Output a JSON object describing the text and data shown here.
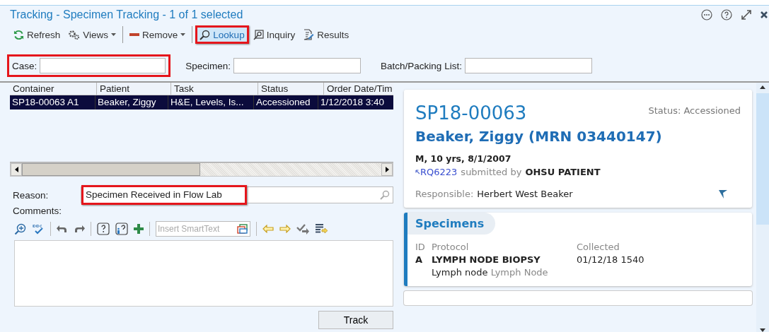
{
  "window": {
    "title": "Tracking - Specimen Tracking - 1 of 1 selected"
  },
  "toolbar": [
    {
      "kind": "refresh",
      "label": "Refresh",
      "dropdown": false,
      "highlighted": false
    },
    {
      "kind": "views",
      "label": "Views",
      "dropdown": true,
      "highlighted": false
    },
    {
      "kind": "remove",
      "label": "Remove",
      "dropdown": true,
      "highlighted": false
    },
    {
      "kind": "lookup",
      "label": "Lookup",
      "dropdown": false,
      "highlighted": true
    },
    {
      "kind": "inquiry",
      "label": "Inquiry",
      "dropdown": false,
      "highlighted": false
    },
    {
      "kind": "results",
      "label": "Results",
      "dropdown": false,
      "highlighted": false
    }
  ],
  "filters": [
    {
      "label": "Case:",
      "highlighted": true
    },
    {
      "label": "Specimen:",
      "highlighted": false
    },
    {
      "label": "Batch/Packing List:",
      "highlighted": false
    }
  ],
  "table": {
    "columns": [
      "Container",
      "Patient",
      "Task",
      "Status",
      "Order Date/Tim"
    ],
    "rows": [
      {
        "selected": true,
        "cells": [
          "SP18-00063 A1",
          "Beaker, Ziggy",
          "H&E, Levels, Is...",
          "Accessioned",
          "1/12/2018  3:40"
        ]
      }
    ]
  },
  "reason": {
    "label": "Reason:",
    "value": "Specimen Received in Flow Lab",
    "highlighted": true
  },
  "comments": {
    "label": "Comments:",
    "smarttext_placeholder": "Insert SmartText"
  },
  "track_button": "Track",
  "detail": {
    "case_id": "SP18-00063",
    "status": "Status: Accessioned",
    "patient": "Beaker, Ziggy (MRN 03440147)",
    "demographics": "M, 10 yrs, 8/1/2007",
    "requisition": "RQ6223",
    "submitted_by_label": "submitted by",
    "submitter": "OHSU PATIENT",
    "responsible_label": "Responsible:",
    "responsible": "Herbert West Beaker"
  },
  "specimens": {
    "title": "Specimens",
    "columns": [
      "ID",
      "Protocol",
      "Collected"
    ],
    "rows": [
      {
        "id": "A",
        "protocol": "LYMPH NODE BIOPSY",
        "collected": "01/12/18 1540",
        "source": "Lymph node",
        "source_detail": "Lymph Node"
      }
    ]
  }
}
